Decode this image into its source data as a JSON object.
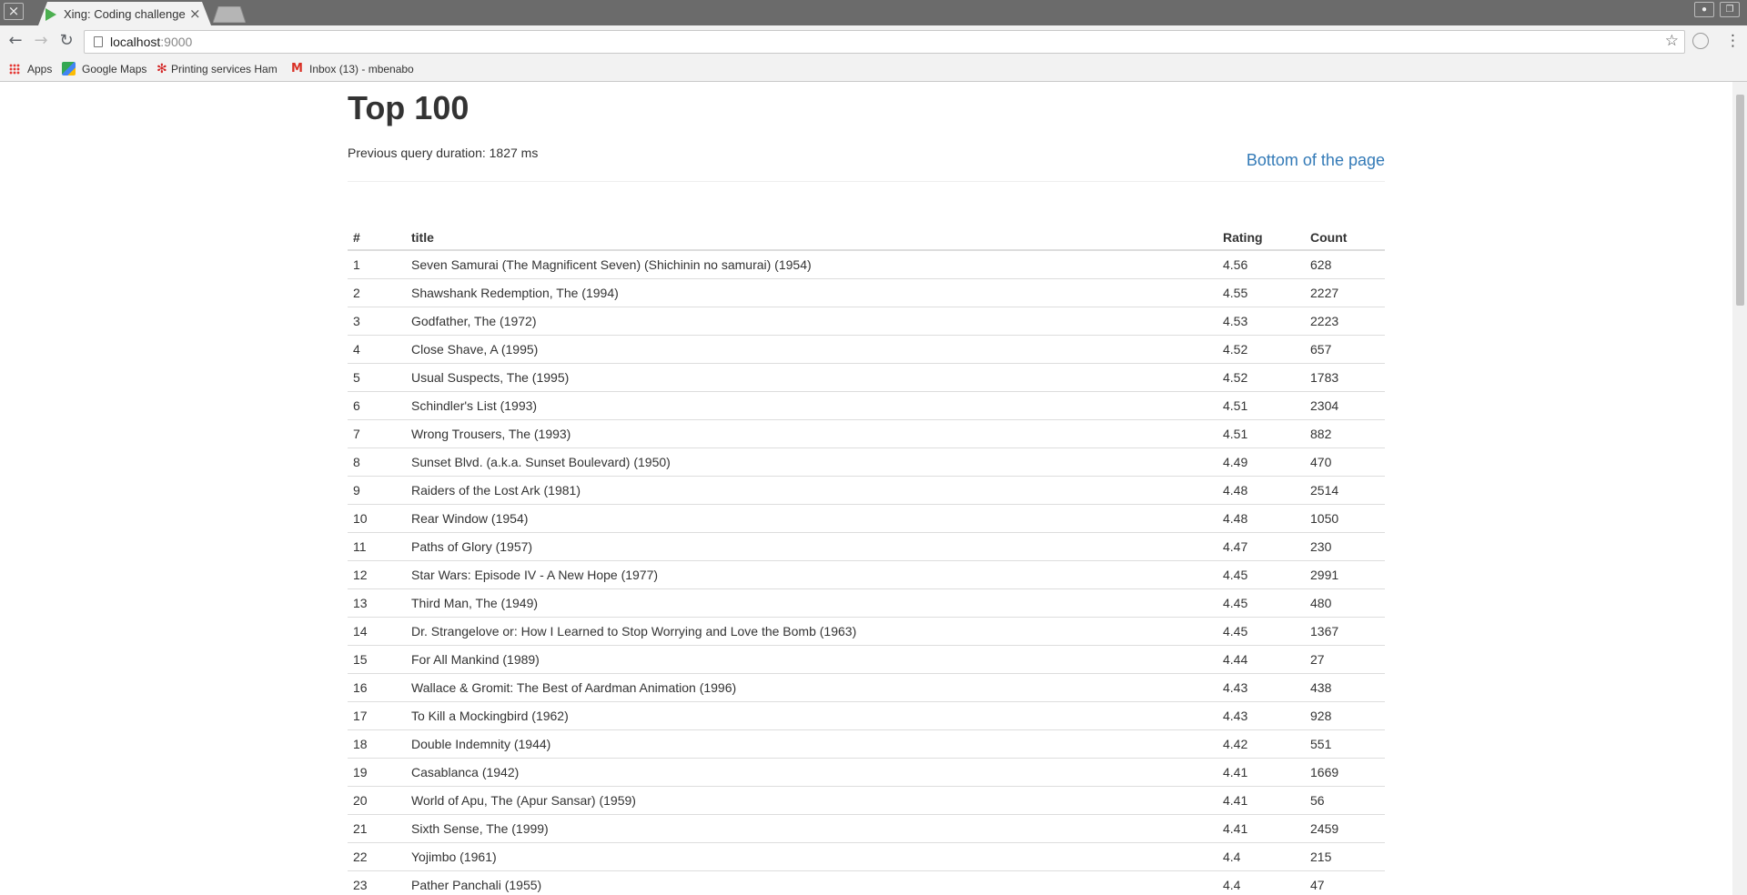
{
  "browser": {
    "tab_title": "Xing: Coding challenge",
    "url_host": "localhost",
    "url_port": ":9000",
    "bookmarks": [
      {
        "label": "Apps",
        "icon": "apps-grid-icon"
      },
      {
        "label": "Google Maps",
        "icon": "google-maps-icon"
      },
      {
        "label": "Printing services Ham",
        "icon": "yelp-icon"
      },
      {
        "label": "Inbox (13) - mbenabo",
        "icon": "gmail-icon"
      }
    ]
  },
  "page": {
    "heading": "Top 100",
    "duration": "Previous query duration: 1827 ms",
    "bottom_link": "Bottom of the page"
  },
  "table": {
    "headers": {
      "num": "#",
      "title": "title",
      "rating": "Rating",
      "count": "Count"
    },
    "rows": [
      {
        "num": "1",
        "title": "Seven Samurai (The Magnificent Seven) (Shichinin no samurai) (1954)",
        "rating": "4.56",
        "count": "628"
      },
      {
        "num": "2",
        "title": "Shawshank Redemption, The (1994)",
        "rating": "4.55",
        "count": "2227"
      },
      {
        "num": "3",
        "title": "Godfather, The (1972)",
        "rating": "4.53",
        "count": "2223"
      },
      {
        "num": "4",
        "title": "Close Shave, A (1995)",
        "rating": "4.52",
        "count": "657"
      },
      {
        "num": "5",
        "title": "Usual Suspects, The (1995)",
        "rating": "4.52",
        "count": "1783"
      },
      {
        "num": "6",
        "title": "Schindler's List (1993)",
        "rating": "4.51",
        "count": "2304"
      },
      {
        "num": "7",
        "title": "Wrong Trousers, The (1993)",
        "rating": "4.51",
        "count": "882"
      },
      {
        "num": "8",
        "title": "Sunset Blvd. (a.k.a. Sunset Boulevard) (1950)",
        "rating": "4.49",
        "count": "470"
      },
      {
        "num": "9",
        "title": "Raiders of the Lost Ark (1981)",
        "rating": "4.48",
        "count": "2514"
      },
      {
        "num": "10",
        "title": "Rear Window (1954)",
        "rating": "4.48",
        "count": "1050"
      },
      {
        "num": "11",
        "title": "Paths of Glory (1957)",
        "rating": "4.47",
        "count": "230"
      },
      {
        "num": "12",
        "title": "Star Wars: Episode IV - A New Hope (1977)",
        "rating": "4.45",
        "count": "2991"
      },
      {
        "num": "13",
        "title": "Third Man, The (1949)",
        "rating": "4.45",
        "count": "480"
      },
      {
        "num": "14",
        "title": "Dr. Strangelove or: How I Learned to Stop Worrying and Love the Bomb (1963)",
        "rating": "4.45",
        "count": "1367"
      },
      {
        "num": "15",
        "title": "For All Mankind (1989)",
        "rating": "4.44",
        "count": "27"
      },
      {
        "num": "16",
        "title": "Wallace & Gromit: The Best of Aardman Animation (1996)",
        "rating": "4.43",
        "count": "438"
      },
      {
        "num": "17",
        "title": "To Kill a Mockingbird (1962)",
        "rating": "4.43",
        "count": "928"
      },
      {
        "num": "18",
        "title": "Double Indemnity (1944)",
        "rating": "4.42",
        "count": "551"
      },
      {
        "num": "19",
        "title": "Casablanca (1942)",
        "rating": "4.41",
        "count": "1669"
      },
      {
        "num": "20",
        "title": "World of Apu, The (Apur Sansar) (1959)",
        "rating": "4.41",
        "count": "56"
      },
      {
        "num": "21",
        "title": "Sixth Sense, The (1999)",
        "rating": "4.41",
        "count": "2459"
      },
      {
        "num": "22",
        "title": "Yojimbo (1961)",
        "rating": "4.4",
        "count": "215"
      },
      {
        "num": "23",
        "title": "Pather Panchali (1955)",
        "rating": "4.4",
        "count": "47"
      }
    ]
  }
}
